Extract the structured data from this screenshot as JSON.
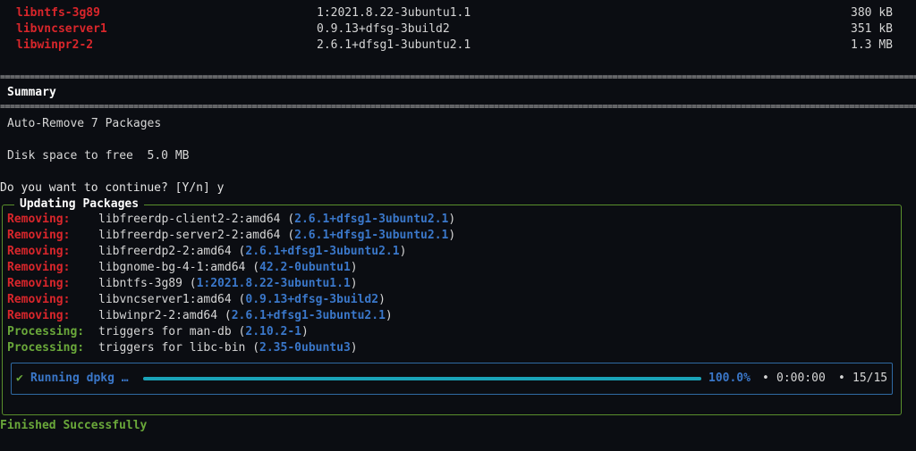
{
  "packages": [
    {
      "name": "libntfs-3g89",
      "version": "1:2021.8.22-3ubuntu1.1",
      "size": "380 kB"
    },
    {
      "name": "libvncserver1",
      "version": "0.9.13+dfsg-3build2",
      "size": "351 kB"
    },
    {
      "name": "libwinpr2-2",
      "version": "2.6.1+dfsg1-3ubuntu2.1",
      "size": "1.3 MB"
    }
  ],
  "summary": {
    "title": "Summary",
    "auto_remove": "Auto-Remove 7 Packages",
    "disk_space": "Disk space to free  5.0 MB"
  },
  "prompt": "Do you want to continue? [Y/n] y",
  "panel": {
    "title": "Updating Packages",
    "entries": [
      {
        "label": "Removing:",
        "kind": "removing",
        "text": "libfreerdp-client2-2:amd64",
        "version": "2.6.1+dfsg1-3ubuntu2.1"
      },
      {
        "label": "Removing:",
        "kind": "removing",
        "text": "libfreerdp-server2-2:amd64",
        "version": "2.6.1+dfsg1-3ubuntu2.1"
      },
      {
        "label": "Removing:",
        "kind": "removing",
        "text": "libfreerdp2-2:amd64",
        "version": "2.6.1+dfsg1-3ubuntu2.1"
      },
      {
        "label": "Removing:",
        "kind": "removing",
        "text": "libgnome-bg-4-1:amd64",
        "version": "42.2-0ubuntu1"
      },
      {
        "label": "Removing:",
        "kind": "removing",
        "text": "libntfs-3g89",
        "version": "1:2021.8.22-3ubuntu1.1"
      },
      {
        "label": "Removing:",
        "kind": "removing",
        "text": "libvncserver1:amd64",
        "version": "0.9.13+dfsg-3build2"
      },
      {
        "label": "Removing:",
        "kind": "removing",
        "text": "libwinpr2-2:amd64",
        "version": "2.6.1+dfsg1-3ubuntu2.1"
      },
      {
        "label": "Processing:",
        "kind": "processing",
        "text": "triggers for man-db",
        "version": "2.10.2-1"
      },
      {
        "label": "Processing:",
        "kind": "processing",
        "text": "triggers for libc-bin",
        "version": "2.35-0ubuntu3"
      }
    ]
  },
  "progress": {
    "check_icon": "✔",
    "label": "Running dpkg …",
    "fraction": 1.0,
    "percent_text": "100.0%",
    "separator": "•",
    "elapsed": "0:00:00",
    "count": "15/15"
  },
  "finished": "Finished Successfully",
  "colors": {
    "removing": "#d9262b",
    "processing": "#6aa83a",
    "version": "#3a77c9",
    "bar": "#1aa3b8",
    "panel_border": "#5a8f2c"
  }
}
